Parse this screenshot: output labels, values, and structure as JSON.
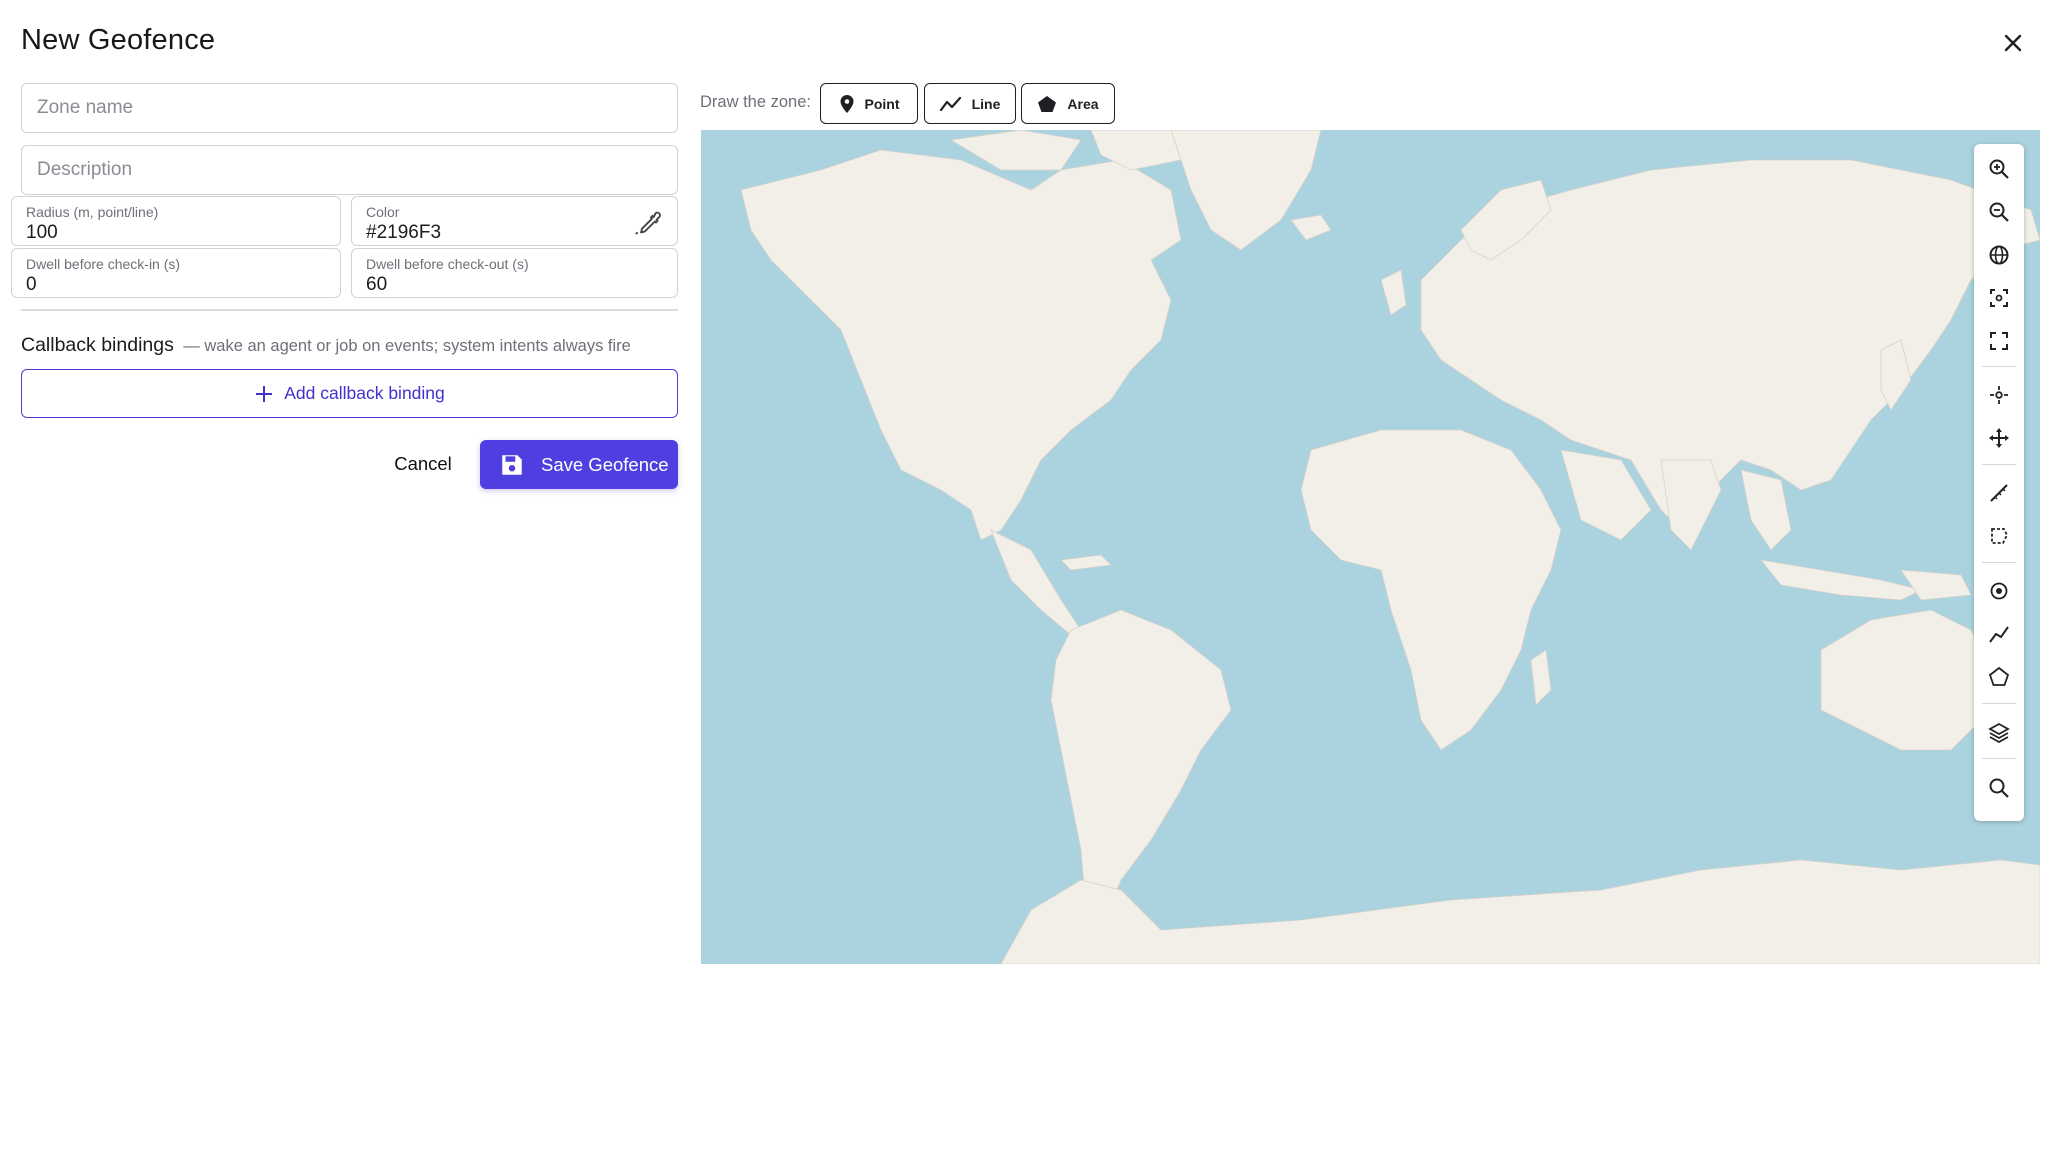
{
  "dialog": {
    "title": "New Geofence"
  },
  "form": {
    "zone_name_placeholder": "Zone name",
    "description_placeholder": "Description",
    "radius": {
      "label": "Radius (m, point/line)",
      "value": "100"
    },
    "color": {
      "label": "Color",
      "value": "#2196F3"
    },
    "dwell_in": {
      "label": "Dwell before check-in (s)",
      "value": "0"
    },
    "dwell_out": {
      "label": "Dwell before check-out (s)",
      "value": "60"
    }
  },
  "callbacks": {
    "title": "Callback bindings",
    "subtitle": "— wake an agent or job on events; system intents always fire",
    "add_label": "Add callback binding"
  },
  "actions": {
    "cancel_label": "Cancel",
    "save_label": "Save Geofence"
  },
  "draw": {
    "label": "Draw the zone:",
    "modes": [
      {
        "label": "Point",
        "icon": "map-pin-icon"
      },
      {
        "label": "Line",
        "icon": "polyline-icon"
      },
      {
        "label": "Area",
        "icon": "pentagon-icon"
      }
    ]
  },
  "map_toolbar": {
    "tools": [
      "zoom-in-icon",
      "zoom-out-icon",
      "globe-icon",
      "zoom-to-selection-icon",
      "fullscreen-icon",
      "locate-icon",
      "pan-icon",
      "measure-line-icon",
      "measure-area-icon",
      "draw-point-icon",
      "draw-line-icon",
      "draw-polygon-icon",
      "layers-icon",
      "search-icon"
    ]
  },
  "colors": {
    "accent": "#4f3fe0",
    "water": "#aad3df",
    "land": "#f2efe9"
  }
}
